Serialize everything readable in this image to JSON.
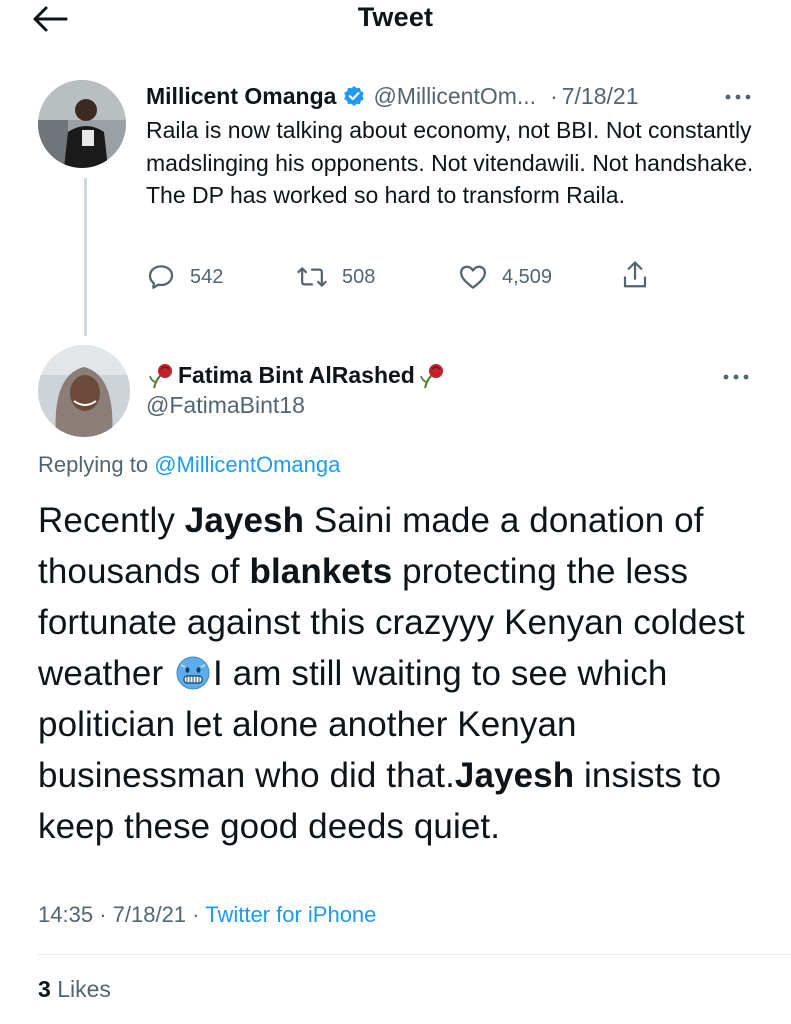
{
  "header": {
    "title": "Tweet",
    "back_icon": "back-arrow-icon"
  },
  "parent_tweet": {
    "author_name": "Millicent Omanga",
    "verified_icon": "verified-badge-icon",
    "handle": "@MillicentOm...",
    "date": "7/18/21",
    "date_sep": "·",
    "text": "Raila is now talking about economy, not BBI. Not constantly madslinging his opponents. Not vitendawili. Not handshake. The DP has worked so hard to transform Raila.",
    "replies": "542",
    "retweets": "508",
    "likes": "4,509"
  },
  "reply_tweet": {
    "author_name": "Fatima Bint AlRashed",
    "handle": "@FatimaBint18",
    "replying_prefix": "Replying to",
    "replying_to": "@MillicentOmanga",
    "body": {
      "p1": "Recently ",
      "b1": "Jayesh",
      "p2": " Saini made a donation of thousands of ",
      "b2": "blankets",
      "p3": " protecting the less fortunate against this crazyyy Kenyan coldest weather ",
      "emoji": "cold-face-emoji",
      "p4": "I am still waiting to see which politician let alone another Kenyan businessman who did that.",
      "b3": "Jayesh",
      "p5": " insists to keep these good deeds quiet."
    },
    "time": "14:35",
    "date": "7/18/21",
    "source": "Twitter for iPhone",
    "sep": "·",
    "likes_count": "3",
    "likes_label": "Likes"
  },
  "colors": {
    "accent": "#1d9bf0",
    "secondary_text": "#536471",
    "primary_text": "#0f1419"
  }
}
